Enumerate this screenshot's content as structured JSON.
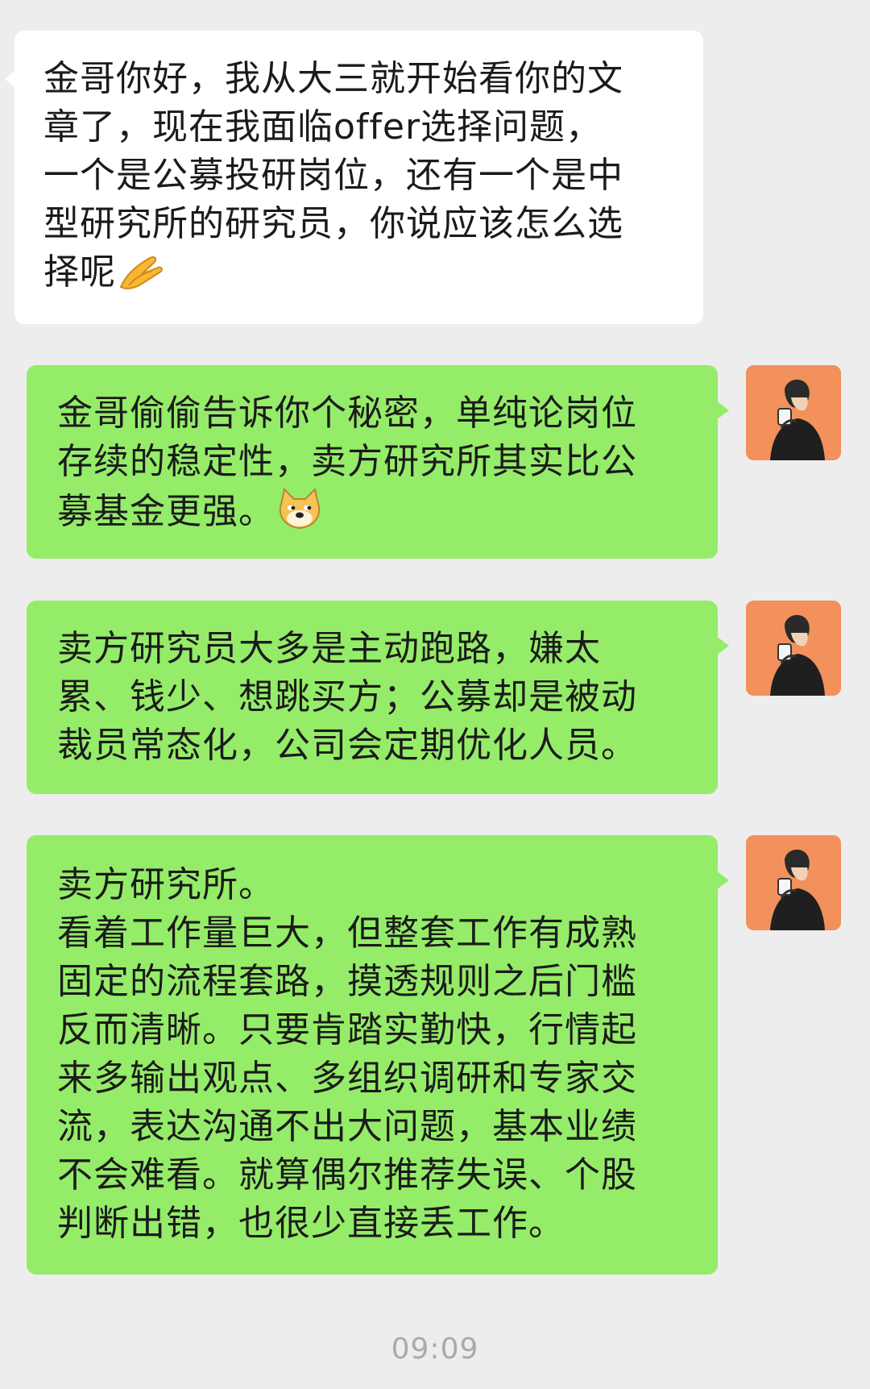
{
  "messages": [
    {
      "sender": "other",
      "text": "金哥你好，我从大三就开始看你的文\n章了，现在我面临offer选择问题，\n一个是公募投研岗位，还有一个是中\n型研究所的研究员，你说应该怎么选\n择呢",
      "emoji": "clapping-hands-emoji"
    },
    {
      "sender": "self",
      "text": "金哥偷偷告诉你个秘密，单纯论岗位\n存续的稳定性，卖方研究所其实比公\n募基金更强。",
      "emoji": "doge-emoji"
    },
    {
      "sender": "self",
      "text": "卖方研究员大多是主动跑路，嫌太\n累、钱少、想跳买方；公募却是被动\n裁员常态化，公司会定期优化人员。"
    },
    {
      "sender": "self",
      "text": "卖方研究所。\n看着工作量巨大，但整套工作有成熟\n固定的流程套路，摸透规则之后门槛\n反而清晰。只要肯踏实勤快，行情起\n来多输出观点、多组织调研和专家交\n流，表达沟通不出大问题，基本业绩\n不会难看。就算偶尔推荐失误、个股\n判断出错，也很少直接丢工作。"
    }
  ],
  "timestamp": "09:09",
  "colors": {
    "background": "#ededed",
    "incoming_bubble": "#ffffff",
    "outgoing_bubble": "#95ec69",
    "avatar_bg": "#f2915b",
    "timestamp": "#a9a9a9"
  }
}
